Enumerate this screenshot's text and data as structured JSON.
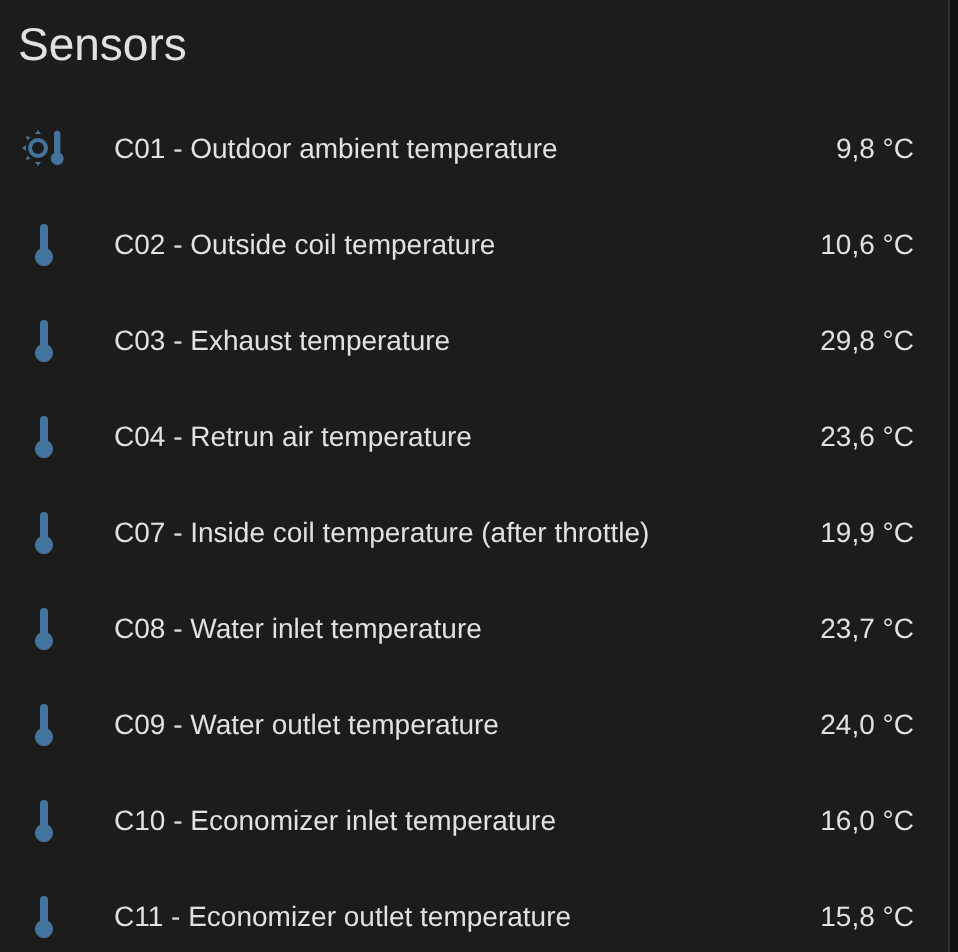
{
  "card": {
    "title": "Sensors",
    "rows": [
      {
        "kind": "sun-thermometer",
        "name": "C01 - Outdoor ambient temperature",
        "value": "9,8 °C"
      },
      {
        "kind": "thermometer",
        "name": "C02 - Outside coil temperature",
        "value": "10,6 °C"
      },
      {
        "kind": "thermometer",
        "name": "C03 - Exhaust temperature",
        "value": "29,8 °C"
      },
      {
        "kind": "thermometer",
        "name": "C04 - Retrun air temperature",
        "value": "23,6 °C"
      },
      {
        "kind": "thermometer",
        "name": "C07 - Inside coil temperature (after throttle)",
        "value": "19,9 °C"
      },
      {
        "kind": "thermometer",
        "name": "C08 - Water inlet temperature",
        "value": "23,7 °C"
      },
      {
        "kind": "thermometer",
        "name": "C09 - Water outlet temperature",
        "value": "24,0 °C"
      },
      {
        "kind": "thermometer",
        "name": "C10 - Economizer inlet temperature",
        "value": "16,0 °C"
      },
      {
        "kind": "thermometer",
        "name": "C11 - Economizer outlet temperature",
        "value": "15,8 °C"
      }
    ]
  }
}
